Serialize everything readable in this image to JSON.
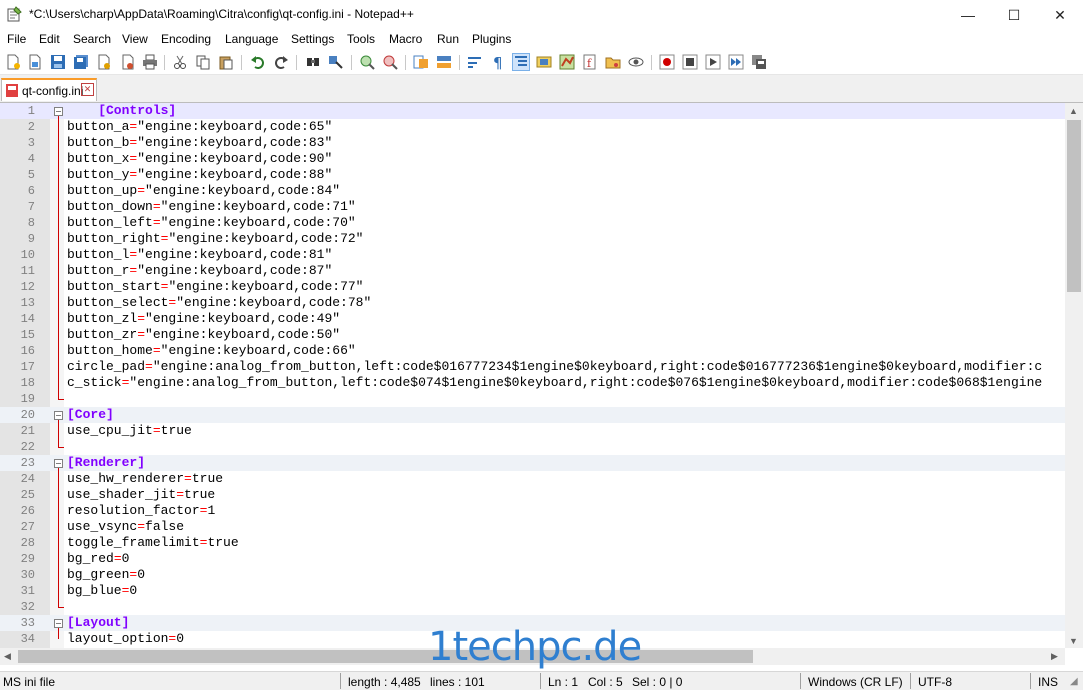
{
  "window": {
    "title": "*C:\\Users\\charp\\AppData\\Roaming\\Citra\\config\\qt-config.ini - Notepad++",
    "minimize": "—",
    "maximize": "☐",
    "close": "✕"
  },
  "menu": [
    "File",
    "Edit",
    "Search",
    "View",
    "Encoding",
    "Language",
    "Settings",
    "Tools",
    "Macro",
    "Run",
    "Plugins"
  ],
  "tab": {
    "label": "qt-config.ini",
    "close": "✕"
  },
  "lines": [
    {
      "n": "1",
      "type": "section",
      "text": "    [Controls]",
      "hl": true
    },
    {
      "n": "2",
      "type": "kv",
      "key": "button_a",
      "eq": "=",
      "val": "\"engine:keyboard,code:65\""
    },
    {
      "n": "3",
      "type": "kv",
      "key": "button_b",
      "eq": "=",
      "val": "\"engine:keyboard,code:83\""
    },
    {
      "n": "4",
      "type": "kv",
      "key": "button_x",
      "eq": "=",
      "val": "\"engine:keyboard,code:90\""
    },
    {
      "n": "5",
      "type": "kv",
      "key": "button_y",
      "eq": "=",
      "val": "\"engine:keyboard,code:88\""
    },
    {
      "n": "6",
      "type": "kv",
      "key": "button_up",
      "eq": "=",
      "val": "\"engine:keyboard,code:84\""
    },
    {
      "n": "7",
      "type": "kv",
      "key": "button_down",
      "eq": "=",
      "val": "\"engine:keyboard,code:71\""
    },
    {
      "n": "8",
      "type": "kv",
      "key": "button_left",
      "eq": "=",
      "val": "\"engine:keyboard,code:70\""
    },
    {
      "n": "9",
      "type": "kv",
      "key": "button_right",
      "eq": "=",
      "val": "\"engine:keyboard,code:72\""
    },
    {
      "n": "10",
      "type": "kv",
      "key": "button_l",
      "eq": "=",
      "val": "\"engine:keyboard,code:81\""
    },
    {
      "n": "11",
      "type": "kv",
      "key": "button_r",
      "eq": "=",
      "val": "\"engine:keyboard,code:87\""
    },
    {
      "n": "12",
      "type": "kv",
      "key": "button_start",
      "eq": "=",
      "val": "\"engine:keyboard,code:77\""
    },
    {
      "n": "13",
      "type": "kv",
      "key": "button_select",
      "eq": "=",
      "val": "\"engine:keyboard,code:78\""
    },
    {
      "n": "14",
      "type": "kv",
      "key": "button_zl",
      "eq": "=",
      "val": "\"engine:keyboard,code:49\""
    },
    {
      "n": "15",
      "type": "kv",
      "key": "button_zr",
      "eq": "=",
      "val": "\"engine:keyboard,code:50\""
    },
    {
      "n": "16",
      "type": "kv",
      "key": "button_home",
      "eq": "=",
      "val": "\"engine:keyboard,code:66\""
    },
    {
      "n": "17",
      "type": "kv",
      "key": "circle_pad",
      "eq": "=",
      "val": "\"engine:analog_from_button,left:code$016777234$1engine$0keyboard,right:code$016777236$1engine$0keyboard,modifier:c"
    },
    {
      "n": "18",
      "type": "kv",
      "key": "c_stick",
      "eq": "=",
      "val": "\"engine:analog_from_button,left:code$074$1engine$0keyboard,right:code$076$1engine$0keyboard,modifier:code$068$1engine"
    },
    {
      "n": "19",
      "type": "empty"
    },
    {
      "n": "20",
      "type": "section",
      "text": "[Core]"
    },
    {
      "n": "21",
      "type": "kv",
      "key": "use_cpu_jit",
      "eq": "=",
      "val": "true"
    },
    {
      "n": "22",
      "type": "empty"
    },
    {
      "n": "23",
      "type": "section",
      "text": "[Renderer]"
    },
    {
      "n": "24",
      "type": "kv",
      "key": "use_hw_renderer",
      "eq": "=",
      "val": "true"
    },
    {
      "n": "25",
      "type": "kv",
      "key": "use_shader_jit",
      "eq": "=",
      "val": "true"
    },
    {
      "n": "26",
      "type": "kv",
      "key": "resolution_factor",
      "eq": "=",
      "val": "1"
    },
    {
      "n": "27",
      "type": "kv",
      "key": "use_vsync",
      "eq": "=",
      "val": "false"
    },
    {
      "n": "28",
      "type": "kv",
      "key": "toggle_framelimit",
      "eq": "=",
      "val": "true"
    },
    {
      "n": "29",
      "type": "kv",
      "key": "bg_red",
      "eq": "=",
      "val": "0"
    },
    {
      "n": "30",
      "type": "kv",
      "key": "bg_green",
      "eq": "=",
      "val": "0"
    },
    {
      "n": "31",
      "type": "kv",
      "key": "bg_blue",
      "eq": "=",
      "val": "0"
    },
    {
      "n": "32",
      "type": "empty"
    },
    {
      "n": "33",
      "type": "section",
      "text": "[Layout]"
    },
    {
      "n": "34",
      "type": "kv",
      "key": "layout_option",
      "eq": "=",
      "val": "0"
    }
  ],
  "status": {
    "filetype": "MS ini file",
    "length": "length : 4,485",
    "lines": "lines : 101",
    "ln": "Ln : 1",
    "col": "Col : 5",
    "sel": "Sel : 0 | 0",
    "eol": "Windows (CR LF)",
    "encoding": "UTF-8",
    "mode": "INS"
  },
  "watermark": "1techpc.de",
  "colors": {
    "section": "#8000ff",
    "operator": "#ff0000",
    "fold": "#d00000",
    "tab_accent": "#fa9b28"
  }
}
